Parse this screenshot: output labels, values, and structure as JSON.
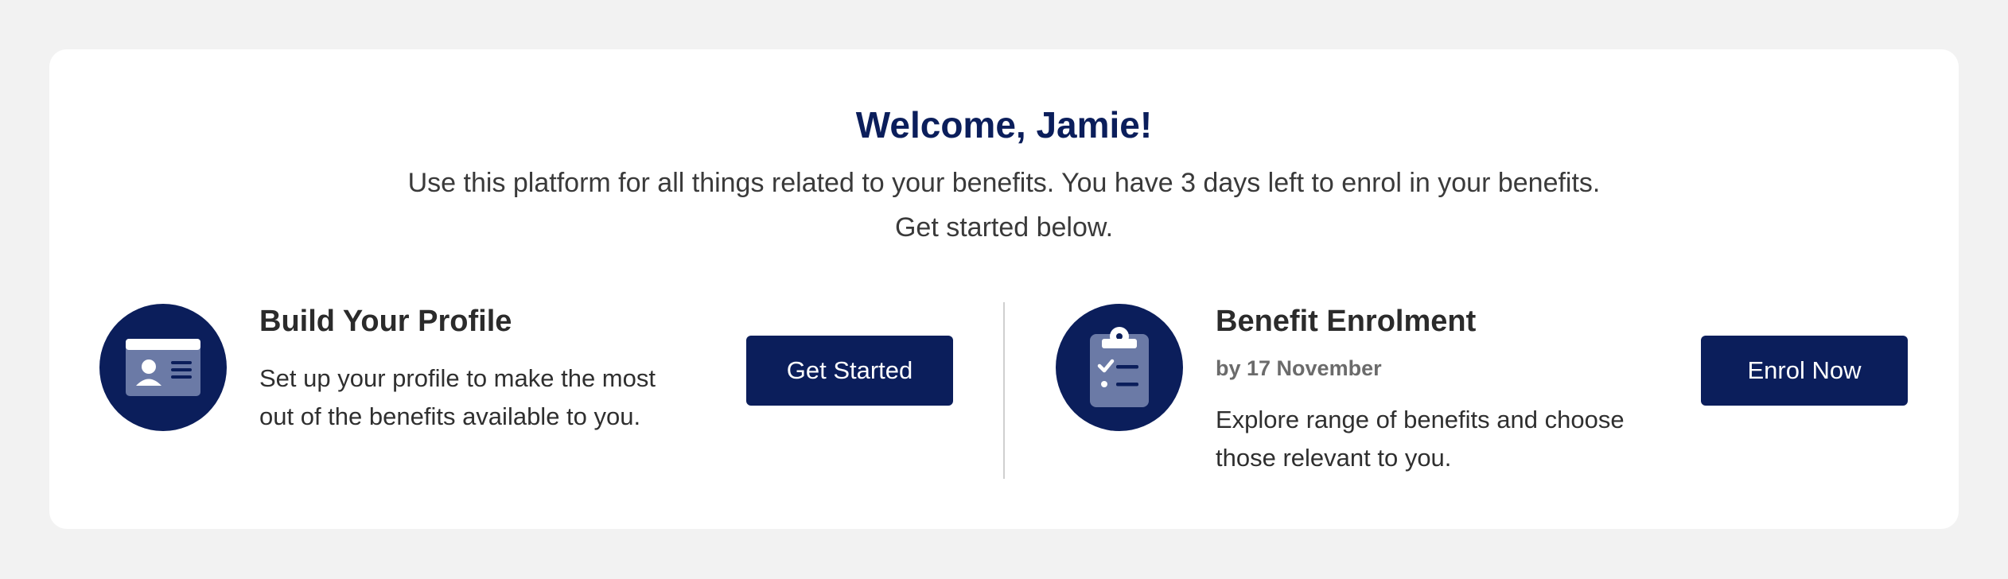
{
  "welcome": {
    "title": "Welcome, Jamie!",
    "subtitle_line1": "Use this platform for all things related to your benefits. You have 3 days left to enrol in your benefits.",
    "subtitle_line2": "Get started below."
  },
  "profile_section": {
    "icon": "id-card-icon",
    "title": "Build Your Profile",
    "description_line1": "Set up your profile to make the most",
    "description_line2": "out of the benefits available to you.",
    "button_label": "Get Started"
  },
  "enrolment_section": {
    "icon": "clipboard-checklist-icon",
    "title": "Benefit Enrolment",
    "deadline": "by 17 November",
    "description_line1": "Explore range of benefits and choose",
    "description_line2": "those relevant to you.",
    "button_label": "Enrol Now"
  },
  "colors": {
    "brand_navy": "#0b1e5b",
    "background": "#f2f2f2",
    "card": "#ffffff",
    "icon_fill": "#6b7aa6"
  }
}
